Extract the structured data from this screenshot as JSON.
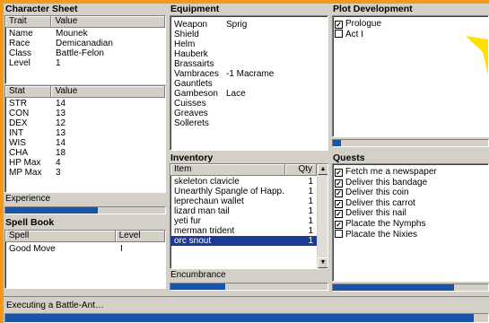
{
  "character_sheet": {
    "title": "Character Sheet",
    "traits_headers": [
      "Trait",
      "Value"
    ],
    "traits": [
      [
        "Name",
        "Mounek"
      ],
      [
        "Race",
        "Demicanadian"
      ],
      [
        "Class",
        "Battle-Felon"
      ],
      [
        "Level",
        "1"
      ]
    ],
    "stats_headers": [
      "Stat",
      "Value"
    ],
    "stats": [
      [
        "STR",
        "14"
      ],
      [
        "CON",
        "13"
      ],
      [
        "DEX",
        "12"
      ],
      [
        "INT",
        "13"
      ],
      [
        "WIS",
        "14"
      ],
      [
        "CHA",
        "18"
      ],
      [
        "HP Max",
        "4"
      ],
      [
        "MP Max",
        "3"
      ]
    ],
    "experience_label": "Experience",
    "experience_progress": 0.58
  },
  "spell_book": {
    "title": "Spell Book",
    "headers": [
      "Spell",
      "Level"
    ],
    "spells": [
      [
        "Good Move",
        "I"
      ]
    ]
  },
  "equipment": {
    "title": "Equipment",
    "items": [
      [
        "Weapon",
        "Sprig"
      ],
      [
        "Shield",
        ""
      ],
      [
        "Helm",
        ""
      ],
      [
        "Hauberk",
        ""
      ],
      [
        "Brassairts",
        ""
      ],
      [
        "Vambraces",
        "-1 Macrame"
      ],
      [
        "Gauntlets",
        ""
      ],
      [
        "Gambeson",
        "Lace"
      ],
      [
        "Cuisses",
        ""
      ],
      [
        "Greaves",
        ""
      ],
      [
        "Sollerets",
        ""
      ]
    ]
  },
  "inventory": {
    "title": "Inventory",
    "headers": [
      "Item",
      "Qty"
    ],
    "items": [
      [
        "skeleton clavicle",
        "1"
      ],
      [
        "Unearthly Spangle of Happ...",
        "1"
      ],
      [
        "leprechaun wallet",
        "1"
      ],
      [
        "lizard man tail",
        "1"
      ],
      [
        "yeti fur",
        "1"
      ],
      [
        "merman trident",
        "1"
      ],
      [
        "orc snout",
        "1"
      ]
    ],
    "selected_index": 6,
    "encumbrance_label": "Encumbrance",
    "encumbrance_progress": 0.35
  },
  "plot": {
    "title": "Plot Development",
    "items": [
      {
        "label": "Prologue",
        "checked": true
      },
      {
        "label": "Act I",
        "checked": false
      }
    ],
    "progress": 0.05
  },
  "quests": {
    "title": "Quests",
    "items": [
      {
        "label": "Fetch me a newspaper",
        "checked": true
      },
      {
        "label": "Deliver this bandage",
        "checked": true
      },
      {
        "label": "Deliver this coin",
        "checked": true
      },
      {
        "label": "Deliver this carrot",
        "checked": true
      },
      {
        "label": "Deliver this nail",
        "checked": true
      },
      {
        "label": "Placate the Nymphs",
        "checked": true
      },
      {
        "label": "Placate the Nixies",
        "checked": false
      }
    ],
    "progress": 0.78
  },
  "status": {
    "task": "Executing a Battle-Ant…",
    "progress": 0.97
  },
  "colors": {
    "background": "#f39a1b",
    "progress_fill": "#1a54a8",
    "selection": "#1c3a94",
    "arrow": "#ffe000"
  }
}
